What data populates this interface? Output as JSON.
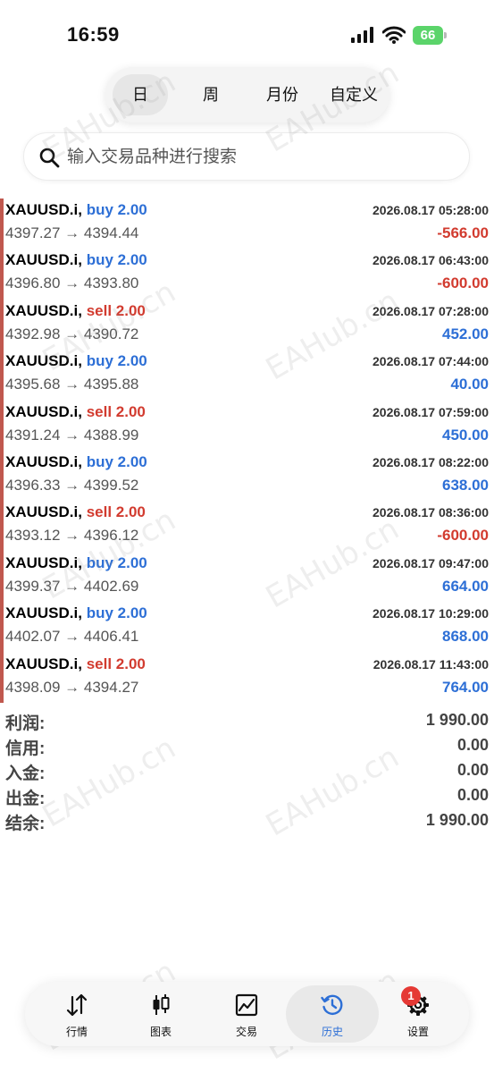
{
  "status_bar": {
    "time": "16:59",
    "battery": "66"
  },
  "period_tabs": [
    {
      "label": "日",
      "active": true
    },
    {
      "label": "周",
      "active": false
    },
    {
      "label": "月份",
      "active": false
    },
    {
      "label": "自定义",
      "active": false
    }
  ],
  "search": {
    "placeholder": "输入交易品种进行搜索"
  },
  "deals": [
    {
      "symbol": "XAUUSD.i,",
      "side": "buy 2.00",
      "time": "2026.08.17 05:28:00",
      "prices": "4397.27 → 4394.44",
      "profit": "-566.00"
    },
    {
      "symbol": "XAUUSD.i,",
      "side": "buy 2.00",
      "time": "2026.08.17 06:43:00",
      "prices": "4396.80 → 4393.80",
      "profit": "-600.00"
    },
    {
      "symbol": "XAUUSD.i,",
      "side": "sell 2.00",
      "time": "2026.08.17 07:28:00",
      "prices": "4392.98 → 4390.72",
      "profit": "452.00"
    },
    {
      "symbol": "XAUUSD.i,",
      "side": "buy 2.00",
      "time": "2026.08.17 07:44:00",
      "prices": "4395.68 → 4395.88",
      "profit": "40.00"
    },
    {
      "symbol": "XAUUSD.i,",
      "side": "sell 2.00",
      "time": "2026.08.17 07:59:00",
      "prices": "4391.24 → 4388.99",
      "profit": "450.00"
    },
    {
      "symbol": "XAUUSD.i,",
      "side": "buy 2.00",
      "time": "2026.08.17 08:22:00",
      "prices": "4396.33 → 4399.52",
      "profit": "638.00"
    },
    {
      "symbol": "XAUUSD.i,",
      "side": "sell 2.00",
      "time": "2026.08.17 08:36:00",
      "prices": "4393.12 → 4396.12",
      "profit": "-600.00"
    },
    {
      "symbol": "XAUUSD.i,",
      "side": "buy 2.00",
      "time": "2026.08.17 09:47:00",
      "prices": "4399.37 → 4402.69",
      "profit": "664.00"
    },
    {
      "symbol": "XAUUSD.i,",
      "side": "buy 2.00",
      "time": "2026.08.17 10:29:00",
      "prices": "4402.07 → 4406.41",
      "profit": "868.00"
    },
    {
      "symbol": "XAUUSD.i,",
      "side": "sell 2.00",
      "time": "2026.08.17 11:43:00",
      "prices": "4398.09 → 4394.27",
      "profit": "764.00"
    }
  ],
  "summary": [
    {
      "label": "利润:",
      "value": "1 990.00"
    },
    {
      "label": "信用:",
      "value": "0.00"
    },
    {
      "label": "入金:",
      "value": "0.00"
    },
    {
      "label": "出金:",
      "value": "0.00"
    },
    {
      "label": "结余:",
      "value": "1 990.00"
    }
  ],
  "watermark": "EAHub.cn",
  "tabs": [
    {
      "label": "行情",
      "icon": "quotes-arrows-icon"
    },
    {
      "label": "图表",
      "icon": "candlestick-chart-icon"
    },
    {
      "label": "交易",
      "icon": "trade-chart-icon"
    },
    {
      "label": "历史",
      "icon": "history-clock-icon",
      "active": true
    },
    {
      "label": "设置",
      "icon": "settings-gear-icon"
    }
  ],
  "settings_badge": "1",
  "colors": {
    "buy": "#2d6fd6",
    "sell": "#d23b2f",
    "accent": "#2d6fd6",
    "rail": "#c0584e",
    "badge": "#e53935"
  }
}
